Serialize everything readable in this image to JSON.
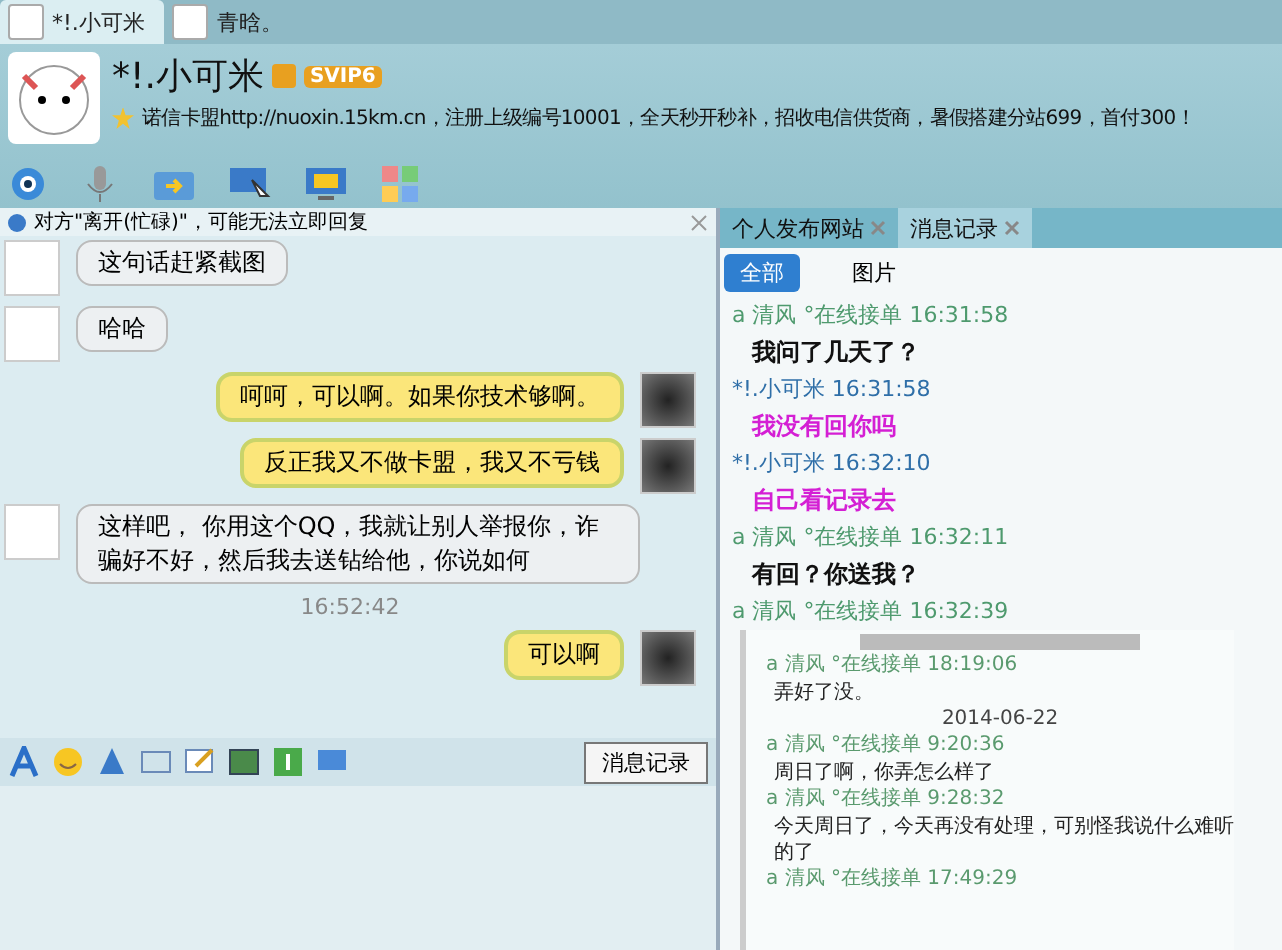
{
  "tabs": [
    {
      "label": "*!.小可米",
      "selected": true
    },
    {
      "label": "青晗。",
      "selected": false
    }
  ],
  "header": {
    "name": "*!.小可米",
    "badge": "SVIP6",
    "signature": "诺信卡盟http://nuoxin.15km.cn，注册上级编号10001，全天秒开秒补，招收电信供货商，暑假搭建分站699，首付300！"
  },
  "notice": "对方\"离开(忙碌)\"，可能无法立即回复",
  "messages": [
    {
      "kind": "incoming",
      "text": "这句话赶紧截图"
    },
    {
      "kind": "incoming",
      "text": "哈哈"
    },
    {
      "kind": "outgoing",
      "text": "呵呵，可以啊。如果你技术够啊。"
    },
    {
      "kind": "outgoing",
      "text": "反正我又不做卡盟，我又不亏钱"
    },
    {
      "kind": "incoming",
      "text": "这样吧， 你用这个QQ，我就让别人举报你，诈骗好不好，然后我去送钻给他，你说如何"
    },
    {
      "kind": "time",
      "text": "16:52:42"
    },
    {
      "kind": "outgoing",
      "text": "可以啊"
    }
  ],
  "history_button": "消息记录",
  "side_tabs": [
    {
      "label": "个人发布网站",
      "selected": false
    },
    {
      "label": "消息记录",
      "selected": true
    }
  ],
  "filters": [
    {
      "label": "全部",
      "selected": true
    },
    {
      "label": "图片",
      "selected": false
    }
  ],
  "records": [
    {
      "kind": "sender",
      "text": "a  清风 °在线接单 16:31:58",
      "color": "#4e9a6e"
    },
    {
      "kind": "message",
      "text": "我问了几天了？",
      "color": "#111111"
    },
    {
      "kind": "sender",
      "text": "*!.小可米 16:31:58",
      "color": "#2f6fa8"
    },
    {
      "kind": "message",
      "text": "我没有回你吗",
      "color": "#d41fd4"
    },
    {
      "kind": "sender",
      "text": "*!.小可米 16:32:10",
      "color": "#2f6fa8"
    },
    {
      "kind": "message",
      "text": "自己看记录去",
      "color": "#d41fd4"
    },
    {
      "kind": "sender",
      "text": "a  清风 °在线接单 16:32:11",
      "color": "#4e9a6e"
    },
    {
      "kind": "message",
      "text": "有回？你送我？",
      "color": "#111111"
    },
    {
      "kind": "sender",
      "text": "a  清风 °在线接单 16:32:39",
      "color": "#4e9a6e"
    }
  ],
  "screenshot": [
    {
      "kind": "sender",
      "text": "a  清风 °在线接单 18:19:06"
    },
    {
      "kind": "message",
      "text": "弄好了没。"
    },
    {
      "kind": "date",
      "text": "2014-06-22"
    },
    {
      "kind": "sender",
      "text": "a  清风 °在线接单 9:20:36"
    },
    {
      "kind": "message",
      "text": "周日了啊，你弄怎么样了"
    },
    {
      "kind": "sender",
      "text": "a  清风 °在线接单 9:28:32"
    },
    {
      "kind": "message",
      "text": "今天周日了，今天再没有处理，可别怪我说什么难听的了"
    },
    {
      "kind": "sender",
      "text": "a  清风 °在线接单 17:49:29"
    }
  ]
}
